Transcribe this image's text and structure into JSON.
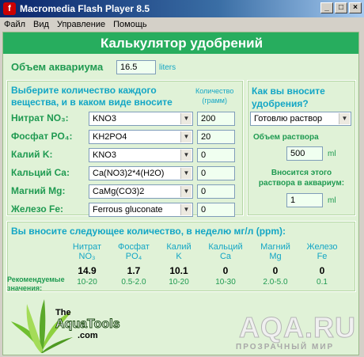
{
  "window": {
    "title": "Macromedia Flash Player 8.5",
    "icon": "flash-icon"
  },
  "menu": [
    "Файл",
    "Вид",
    "Управление",
    "Помощь"
  ],
  "header": {
    "title": "Калькулятор удобрений"
  },
  "aquarium": {
    "label": "Объем аквариума",
    "value": "16.5",
    "unit": "liters"
  },
  "left_panel": {
    "title_line1": "Выберите количество каждого",
    "title_line2": "вещества, и в каком виде вносите",
    "qty_header_line1": "Количество",
    "qty_header_line2": "(грамм)",
    "rows": [
      {
        "label": "Нитрат NO₃:",
        "form": "KNO3",
        "qty": "200"
      },
      {
        "label": "Фосфат PO₄:",
        "form": "KH2PO4",
        "qty": "20"
      },
      {
        "label": "Калий K:",
        "form": "KNO3",
        "qty": "0"
      },
      {
        "label": "Кальций Ca:",
        "form": "Ca(NO3)2*4(H2O)",
        "qty": "0"
      },
      {
        "label": "Магний Mg:",
        "form": "CaMg(CO3)2",
        "qty": "0"
      },
      {
        "label": "Железо Fe:",
        "form": "Ferrous gluconate",
        "qty": "0"
      }
    ]
  },
  "right_panel": {
    "title_line1": "Как вы вносите",
    "title_line2": "удобрения?",
    "method": "Готовлю раствор",
    "volume_label": "Объем раствора",
    "volume_value": "500",
    "volume_unit": "ml",
    "dose_label_line1": "Вносится этого",
    "dose_label_line2": "раствора в аквариум:",
    "dose_value": "1",
    "dose_unit": "ml"
  },
  "results": {
    "title": "Вы вносите следующее количество, в неделю  мг/л (ppm):",
    "recommended_label_line1": "Рекомендуемые",
    "recommended_label_line2": "значения:",
    "columns": [
      {
        "name": "Нитрат",
        "sub": "NO₃",
        "value": "14.9",
        "range": "10-20"
      },
      {
        "name": "Фосфат",
        "sub": "PO₄",
        "value": "1.7",
        "range": "0.5-2.0"
      },
      {
        "name": "Калий",
        "sub": "K",
        "value": "10.1",
        "range": "10-20"
      },
      {
        "name": "Кальций",
        "sub": "Ca",
        "value": "0",
        "range": "10-30"
      },
      {
        "name": "Магний",
        "sub": "Mg",
        "value": "0",
        "range": "2.0-5.0"
      },
      {
        "name": "Железо",
        "sub": "Fe",
        "value": "0",
        "range": "0.1"
      }
    ]
  },
  "footer": {
    "logo_line1": "The",
    "logo_line2": "AquaTools",
    "logo_line3": ".com",
    "watermark": "AQA.RU",
    "watermark_sub": "ПРОЗРАЧНЫЙ МИР"
  },
  "colors": {
    "header_green": "#27ad5e",
    "label_green": "#1f9a51",
    "title_cyan": "#13a6c5",
    "background": "#e0f2d7"
  }
}
